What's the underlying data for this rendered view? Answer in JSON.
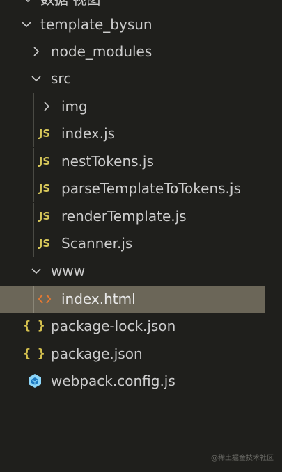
{
  "explorer": {
    "items": [
      {
        "label": "数据 视图",
        "kind": "folder-open"
      },
      {
        "label": "template_bysun",
        "kind": "folder-open"
      },
      {
        "label": "node_modules",
        "kind": "folder-closed"
      },
      {
        "label": "src",
        "kind": "folder-open"
      },
      {
        "label": "img",
        "kind": "folder-closed"
      },
      {
        "label": "index.js",
        "kind": "js",
        "icon_text": "JS"
      },
      {
        "label": "nestTokens.js",
        "kind": "js",
        "icon_text": "JS"
      },
      {
        "label": "parseTemplateToTokens.js",
        "kind": "js",
        "icon_text": "JS"
      },
      {
        "label": "renderTemplate.js",
        "kind": "js",
        "icon_text": "JS"
      },
      {
        "label": "Scanner.js",
        "kind": "js",
        "icon_text": "JS"
      },
      {
        "label": "www",
        "kind": "folder-open"
      },
      {
        "label": "index.html",
        "kind": "html",
        "selected": true
      },
      {
        "label": "package-lock.json",
        "kind": "json",
        "icon_text": "{ }"
      },
      {
        "label": "package.json",
        "kind": "json",
        "icon_text": "{ }"
      },
      {
        "label": "webpack.config.js",
        "kind": "webpack"
      }
    ]
  },
  "watermark": "@稀土掘金技术社区",
  "colors": {
    "background": "#1f1f1c",
    "selected_row": "#6b6658",
    "text": "#cccccc",
    "js_icon": "#d8c85a",
    "json_icon": "#d6c24f",
    "html_icon": "#e37933",
    "webpack_icon": "#8dd6f9"
  }
}
